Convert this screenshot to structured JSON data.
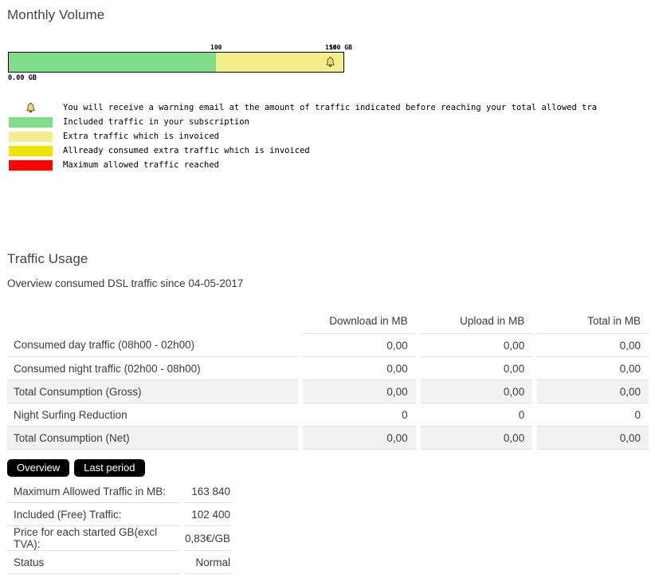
{
  "monthly_volume": {
    "title": "Monthly Volume",
    "bar": {
      "zero_label": "0.00 GB",
      "warning_tick_label": "100",
      "max_tick_label": "150",
      "total_tick_label": "160 GB",
      "included_percent": 62,
      "consumed_percent": 0,
      "bell_icon": "bell-icon",
      "colors": {
        "included": "#7fdd8c",
        "extra": "#f4ee8d",
        "consumed": "#ece500",
        "maximum": "#ff0000",
        "border": "#000000"
      }
    },
    "legend": [
      {
        "icon": "bell-icon",
        "swatch": null,
        "text": "You will  receive a warning email at the amount of traffic indicated before reaching your total allowed tra"
      },
      {
        "icon": null,
        "swatch": "#7fdd8c",
        "text": "Included traffic in your subscription"
      },
      {
        "icon": null,
        "swatch": "#f4ee8d",
        "text": "Extra traffic which is invoiced"
      },
      {
        "icon": null,
        "swatch": "#ece500",
        "text": "Allready consumed extra traffic which is invoiced"
      },
      {
        "icon": null,
        "swatch": "#ff0000",
        "text": "Maximum allowed traffic reached"
      }
    ]
  },
  "traffic_usage": {
    "title": "Traffic Usage",
    "subtitle": "Overview consumed DSL traffic since  04-05-2017",
    "table": {
      "headers": [
        "",
        "Download in MB",
        "Upload in MB",
        "Total in MB"
      ],
      "rows": [
        {
          "label": "Consumed day traffic (08h00 - 02h00)",
          "download": "0,00",
          "upload": "0,00",
          "total": "0,00",
          "shaded": false
        },
        {
          "label": "Consumed night traffic (02h00 - 08h00)",
          "download": "0,00",
          "upload": "0,00",
          "total": "0,00",
          "shaded": false
        },
        {
          "label": "Total Consumption (Gross)",
          "download": "0,00",
          "upload": "0,00",
          "total": "0,00",
          "shaded": true
        },
        {
          "label": "Night Surfing Reduction",
          "download": "0",
          "upload": "0",
          "total": "0",
          "shaded": false
        },
        {
          "label": "Total Consumption (Net)",
          "download": "0,00",
          "upload": "0,00",
          "total": "0,00",
          "shaded": true
        }
      ]
    }
  },
  "tabs": [
    {
      "label": "Overview",
      "active": true
    },
    {
      "label": "Last period",
      "active": false
    }
  ],
  "info": {
    "rows": [
      {
        "label": "Maximum Allowed Traffic in MB:",
        "value": "163 840"
      },
      {
        "label": "Included (Free) Traffic:",
        "value": "102 400"
      },
      {
        "label": "Price for each started GB(excl TVA):",
        "value": "0,83€/GB"
      },
      {
        "label": "Status",
        "value": "Normal"
      }
    ]
  }
}
